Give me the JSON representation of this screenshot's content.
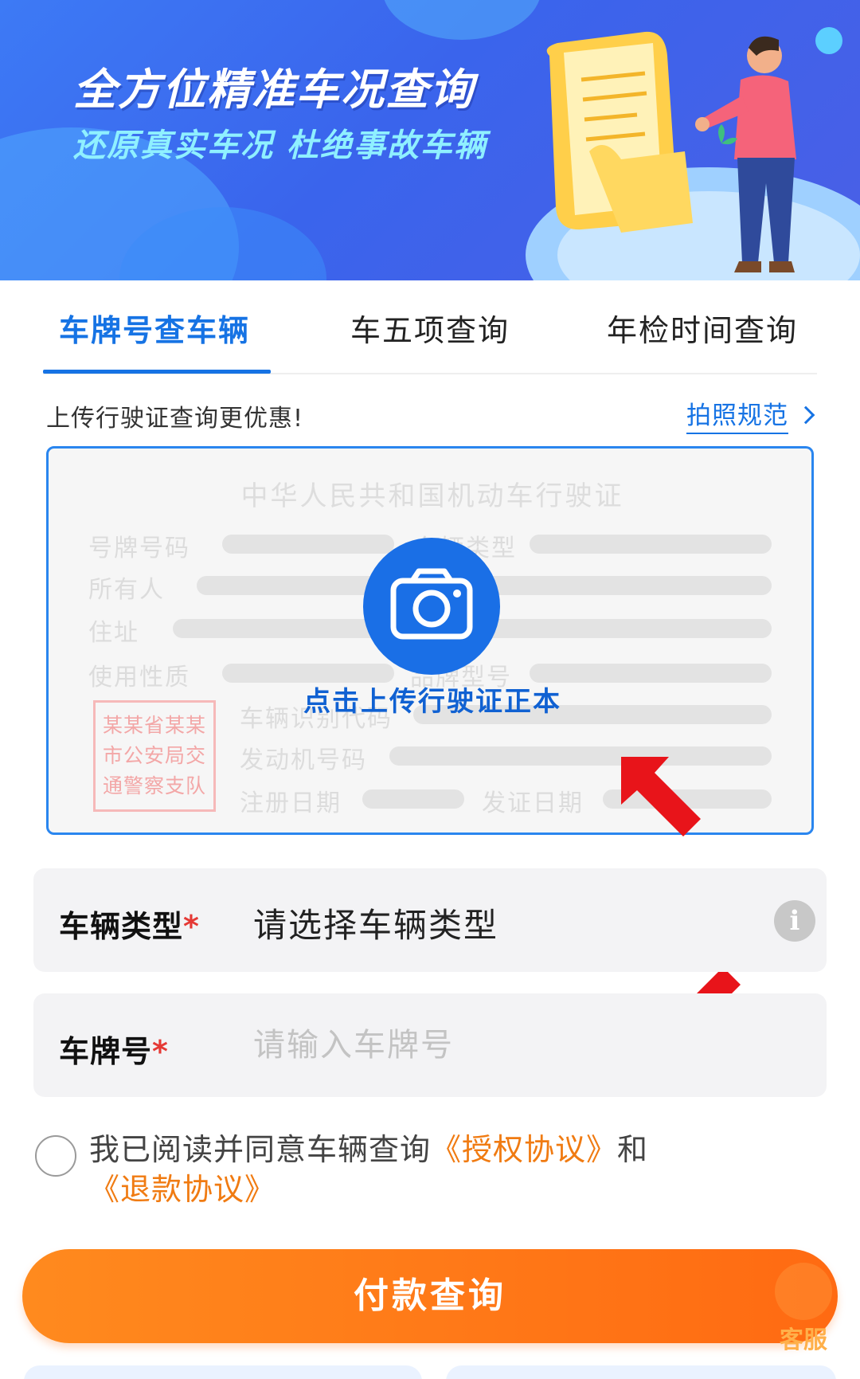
{
  "banner": {
    "title": "全方位精准车况查询",
    "subtitle": "还原真实车况 杜绝事故车辆"
  },
  "tabs": [
    {
      "label": "车牌号查车辆",
      "active": true
    },
    {
      "label": "车五项查询",
      "active": false
    },
    {
      "label": "年检时间查询",
      "active": false
    }
  ],
  "upload": {
    "hint": "上传行驶证查询更优惠!",
    "photo_rule": "拍照规范",
    "card_title": "中华人民共和国机动车行驶证",
    "fields": {
      "plate": "号牌号码",
      "vehicle_type": "车辆类型",
      "owner": "所有人",
      "address": "住址",
      "usage": "使用性质",
      "model": "品牌型号",
      "vin": "车辆识别代码",
      "engine": "发动机号码",
      "register_date": "注册日期",
      "issue_date": "发证日期"
    },
    "stamp_lines": [
      "某某省某某",
      "市公安局交",
      "通警察支队"
    ],
    "action": "点击上传行驶证正本"
  },
  "form": {
    "vehicle_type": {
      "label": "车辆类型",
      "required_mark": "*",
      "value": "请选择车辆类型",
      "info_icon": "i"
    },
    "plate": {
      "label": "车牌号",
      "required_mark": "*",
      "placeholder": "请输入车牌号"
    }
  },
  "agreement": {
    "prefix": "我已阅读并同意车辆查询",
    "auth_link": "《授权协议》",
    "and": "和",
    "refund_link": "《退款协议》"
  },
  "submit": {
    "label": "付款查询"
  },
  "service": {
    "label": "客服"
  },
  "colors": {
    "primary_blue": "#1673e4",
    "orange": "#ff7a18",
    "link_orange": "#f07b12",
    "required_red": "#e53935",
    "arrow_red": "#e8141a"
  }
}
